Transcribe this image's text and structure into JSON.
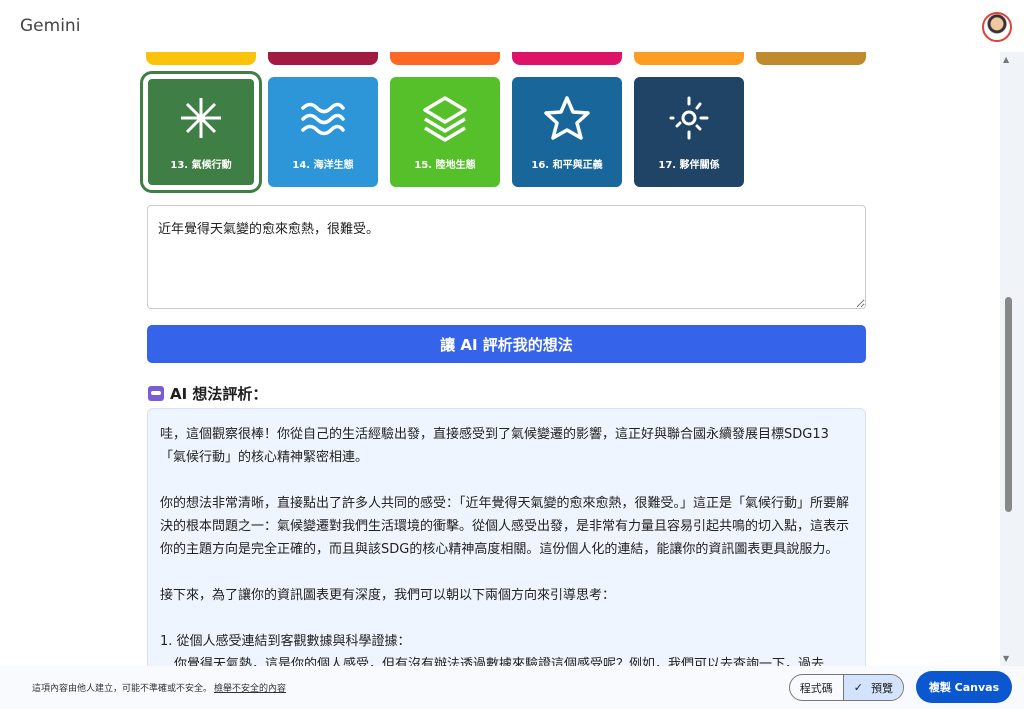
{
  "header": {
    "title": "Gemini"
  },
  "top_row_colors": [
    "#fcc30b",
    "#a21942",
    "#fd6925",
    "#dd1367",
    "#fd9d24",
    "#bf8b2e"
  ],
  "tiles": [
    {
      "label": "13. 氣候行動",
      "color": "#3f7e44",
      "icon": "sparkle-icon",
      "selected": true
    },
    {
      "label": "14. 海洋生態",
      "color": "#2c96d8",
      "icon": "waves-icon"
    },
    {
      "label": "15. 陸地生態",
      "color": "#56c02b",
      "icon": "layers-icon"
    },
    {
      "label": "16. 和平與正義",
      "color": "#19679a",
      "icon": "star-icon"
    },
    {
      "label": "17. 夥伴關係",
      "color": "#1f4466",
      "icon": "sun-icon"
    }
  ],
  "input": {
    "value": "近年覺得天氣變的愈來愈熱，很難受。"
  },
  "analyze_button": "讓 AI 評析我的想法",
  "result": {
    "heading": "AI 想法評析：",
    "paragraphs": [
      "哇，這個觀察很棒！你從自己的生活經驗出發，直接感受到了氣候變遷的影響，這正好與聯合國永續發展目標SDG13「氣候行動」的核心精神緊密相連。",
      "你的想法非常清晰，直接點出了許多人共同的感受：「近年覺得天氣變的愈來愈熱，很難受。」這正是「氣候行動」所要解決的根本問題之一：氣候變遷對我們生活環境的衝擊。從個人感受出發，是非常有力量且容易引起共鳴的切入點，這表示你的主題方向是完全正確的，而且與該SDG的核心精神高度相關。這份個人化的連結，能讓你的資訊圖表更具說服力。",
      "接下來，為了讓你的資訊圖表更有深度，我們可以朝以下兩個方向來引導思考："
    ],
    "item1_title": "1. 從個人感受連結到客觀數據與科學證據：",
    "item1_text": "你覺得天氣熱，這是你的個人感受，但有沒有辦法透過數據來驗證這個感受呢？例如，我們可以去查詢一下，過去"
  },
  "footer": {
    "disclaimer": "這項內容由他人建立，可能不準確或不安全。",
    "report_link": "檢舉不安全的內容",
    "code_tab": "程式碼",
    "preview_tab": "預覽",
    "copy_button": "複製 Canvas"
  }
}
